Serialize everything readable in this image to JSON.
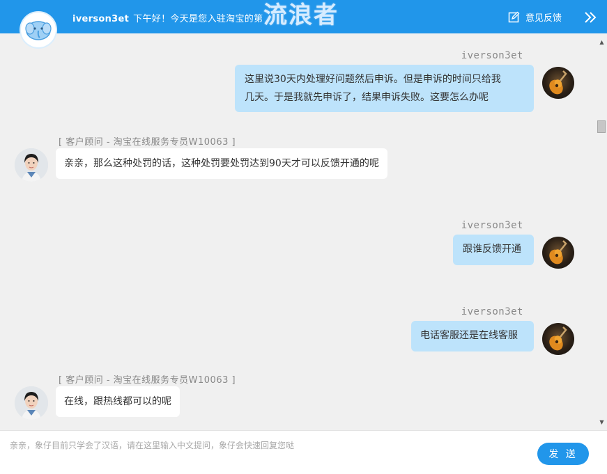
{
  "header": {
    "username": "iverson3et",
    "greeting": "下午好！今天是您入驻淘宝的第",
    "watermark": "流浪者",
    "feedback_label": "意见反馈",
    "feedback_icon": "edit-square-icon",
    "collapse_icon": "double-chevron-right-icon",
    "logo_icon": "elephant-mascot-icon"
  },
  "messages": [
    {
      "side": "right",
      "sender": "iverson3et",
      "lines": [
        "这里说30天内处理好问题然后申诉。但是申诉的时间只给我",
        "几天。于是我就先申诉了，结果申诉失败。这要怎么办呢"
      ]
    },
    {
      "side": "left",
      "sender": "[ 客户顾问 - 淘宝在线服务专员W10063 ]",
      "text": "亲亲，那么这种处罚的话，这种处罚要处罚达到90天才可以反馈开通的呢"
    },
    {
      "side": "right",
      "sender": "iverson3et",
      "text": "跟谁反馈开通"
    },
    {
      "side": "right",
      "sender": "iverson3et",
      "text": "电话客服还是在线客服"
    },
    {
      "side": "left",
      "sender": "[ 客户顾问 - 淘宝在线服务专员W10063 ]",
      "text": "在线，跟热线都可以的呢"
    }
  ],
  "input": {
    "placeholder": "亲亲，象仔目前只学会了汉语，请在这里输入中文提问，象仔会快速回复您哒",
    "value": ""
  },
  "send_label": "发 送",
  "colors": {
    "brand": "#2196ea",
    "user_bubble": "#bde3fb",
    "agent_bubble": "#ffffff",
    "background": "#f0f0f0"
  }
}
